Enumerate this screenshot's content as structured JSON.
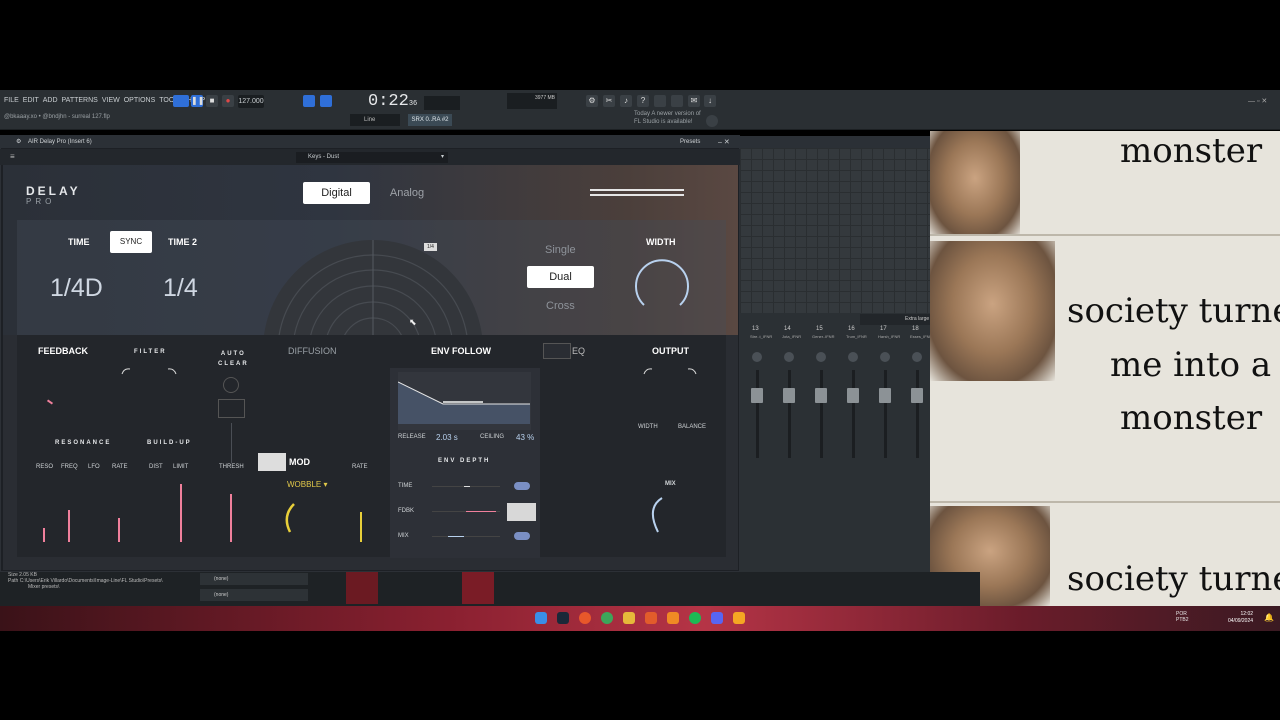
{
  "fl": {
    "menu": [
      "FILE",
      "EDIT",
      "ADD",
      "PATTERNS",
      "VIEW",
      "OPTIONS",
      "TOOLS",
      "HELP"
    ],
    "song": "@bkaaay.xo • @bndjhn - surreal 127.flp",
    "tempo": "127.000",
    "clock_main": "0:22",
    "clock_sub": "36",
    "cpu": "3977 MB",
    "pattern": "SRX 0..RA #2",
    "snap": "Line",
    "news_line1": "Today  A newer version of",
    "news_line2": "FL Studio is available!"
  },
  "plugin": {
    "window_title": "AIR Delay Pro (Insert 6)",
    "presets_label": "Presets",
    "preset_name": "Keys - Dust",
    "logo_top": "DELAY",
    "logo_bottom": "PRO",
    "mode_digital": "Digital",
    "mode_analog": "Analog",
    "time_label": "TIME",
    "sync_label": "SYNC",
    "time2_label": "TIME 2",
    "time1_value": "1/4D",
    "time2_value": "1/4",
    "radar_tag": "1/4",
    "opt_single": "Single",
    "opt_dual": "Dual",
    "opt_cross": "Cross",
    "width_label": "WIDTH",
    "feedback": "FEEDBACK",
    "filter": "FILTER",
    "auto_clear_1": "AUTO",
    "auto_clear_2": "CLEAR",
    "diffusion": "DIFFUSION",
    "env_follow": "ENV FOLLOW",
    "eq": "EQ",
    "output": "OUTPUT",
    "resonance": "RESONANCE",
    "buildup": "BUILD-UP",
    "reso": "RESO",
    "freq": "FREQ",
    "lfo": "LFO",
    "rate": "RATE",
    "dist": "DIST",
    "limit": "LIMIT",
    "thresh": "THRESH",
    "mod": "MOD",
    "mod_rate": "RATE",
    "wobble": "WOBBLE",
    "release_label": "RELEASE",
    "release_value": "2.03 s",
    "ceiling_label": "CEILING",
    "ceiling_value": "43 %",
    "env_depth": "ENV DEPTH",
    "depth_time": "TIME",
    "depth_fdbk": "FDBK",
    "depth_mix": "MIX",
    "out_width": "WIDTH",
    "out_balance": "BALANCE",
    "out_mix": "MIX"
  },
  "mixer": {
    "size_label": "Extra large",
    "channels": [
      {
        "num": "13",
        "name": "Stre..t_IFNR"
      },
      {
        "num": "14",
        "name": "Jota_IFNR"
      },
      {
        "num": "15",
        "name": "Gener..IFNR"
      },
      {
        "num": "16",
        "name": "Trum_IFNR"
      },
      {
        "num": "17",
        "name": "Harsh_IFNR"
      },
      {
        "num": "18",
        "name": "Esses_IFNR"
      },
      {
        "num": "19",
        "name": "Bong_IFNR"
      }
    ]
  },
  "browser": {
    "size_label": "Size",
    "size_value": "2.05 KB",
    "path_label": "Path",
    "path_value": "C:\\Users\\Erik Villardo\\Documents\\Image-Line\\FL Studio\\Presets\\",
    "path_value2": "Mixer presets\\",
    "none1": "(none)",
    "none2": "(none)"
  },
  "meme": {
    "line1": "monster",
    "line2": "society turne",
    "line3": "me into a",
    "line4": "monster",
    "line5": "society turne"
  },
  "taskbar": {
    "lang1": "POR",
    "lang2": "PTB2",
    "time": "12:02",
    "date": "04/09/2024"
  }
}
